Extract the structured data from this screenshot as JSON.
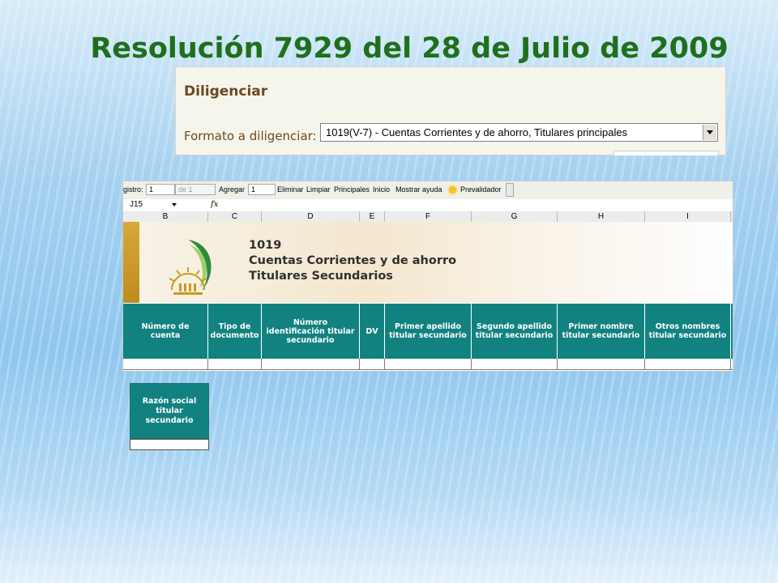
{
  "slide": {
    "title": "Resolución 7929 del 28 de Julio de 2009"
  },
  "diligenciar": {
    "heading": "Diligenciar",
    "format_label": "Formato a diligenciar:",
    "selected_format": "1019(V-7) - Cuentas Corrientes y de ahorro, Titulares principales"
  },
  "toolbar": {
    "registro_label": "gistro:",
    "registro_value": "1",
    "de_label": "de 1",
    "agregar_label": "Agregar",
    "agregar_value": "1",
    "eliminar": "Eliminar",
    "limpiar": "Limpiar",
    "principales": "Principales",
    "inicio": "Inicio",
    "mostrar_ayuda": "Mostrar ayuda",
    "prevalidador": "Prevalidador"
  },
  "formula_bar": {
    "cell_ref": "J15",
    "fx": "fx"
  },
  "columns": [
    "B",
    "C",
    "D",
    "E",
    "F",
    "G",
    "H",
    "I"
  ],
  "banner": {
    "code": "1019",
    "line1": "Cuentas Corrientes y de ahorro",
    "line2": "Titulares Secundarios"
  },
  "headers": [
    "Número de cuenta",
    "Tipo de documento",
    "Número identificación titular secundario",
    "DV",
    "Primer apellido titular secundario",
    "Segundo apellido titular secundario",
    "Primer nombre titular secundario",
    "Otros nombres titular secundario"
  ],
  "razon_social": {
    "header": "Razón social titular secundario"
  },
  "colors": {
    "title_green": "#1f6f1c",
    "header_teal": "#128280",
    "banner_gold": "#c08b1d"
  }
}
